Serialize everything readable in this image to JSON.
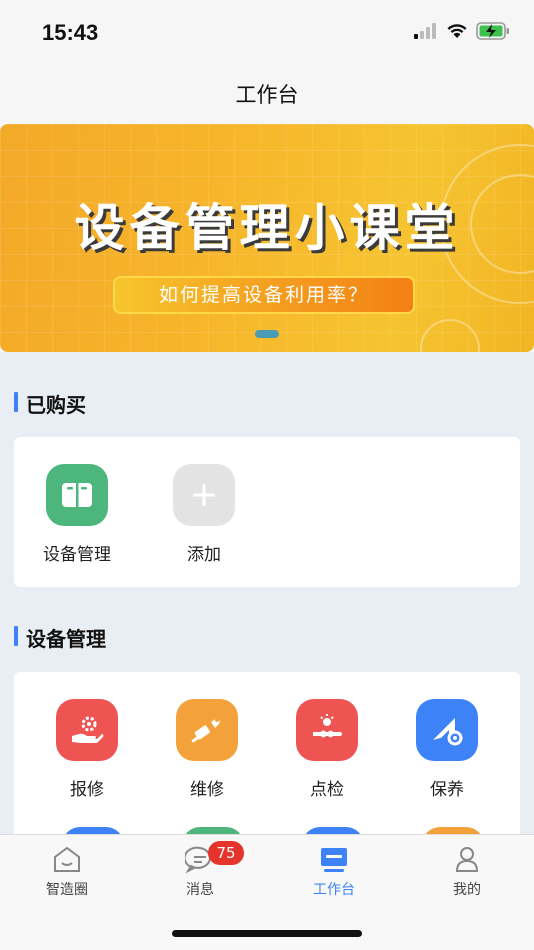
{
  "status_bar": {
    "time": "15:43"
  },
  "nav": {
    "title": "工作台"
  },
  "banner": {
    "title": "设备管理小课堂",
    "subtitle": "如何提高设备利用率？"
  },
  "purchased": {
    "title": "已购买",
    "items": [
      {
        "label": "设备管理",
        "icon": "device-management-icon",
        "color": "#4db67d"
      },
      {
        "label": "添加",
        "icon": "add-icon",
        "color": "#e3e3e3"
      }
    ]
  },
  "device_management": {
    "title": "设备管理",
    "items": [
      {
        "label": "报修",
        "icon": "repair-report-icon",
        "color": "#ee5452"
      },
      {
        "label": "维修",
        "icon": "repair-icon",
        "color": "#f3a23b"
      },
      {
        "label": "点检",
        "icon": "inspection-icon",
        "color": "#ee5452"
      },
      {
        "label": "保养",
        "icon": "maintenance-icon",
        "color": "#3d83f7"
      }
    ]
  },
  "tab_bar": {
    "tabs": [
      {
        "label": "智造圈",
        "icon": "home-icon"
      },
      {
        "label": "消息",
        "icon": "message-icon",
        "badge": "75"
      },
      {
        "label": "工作台",
        "icon": "workbench-icon",
        "active": true
      },
      {
        "label": "我的",
        "icon": "profile-icon"
      }
    ]
  },
  "colors": {
    "accent": "#3d83f7",
    "badge": "#e5342b"
  }
}
